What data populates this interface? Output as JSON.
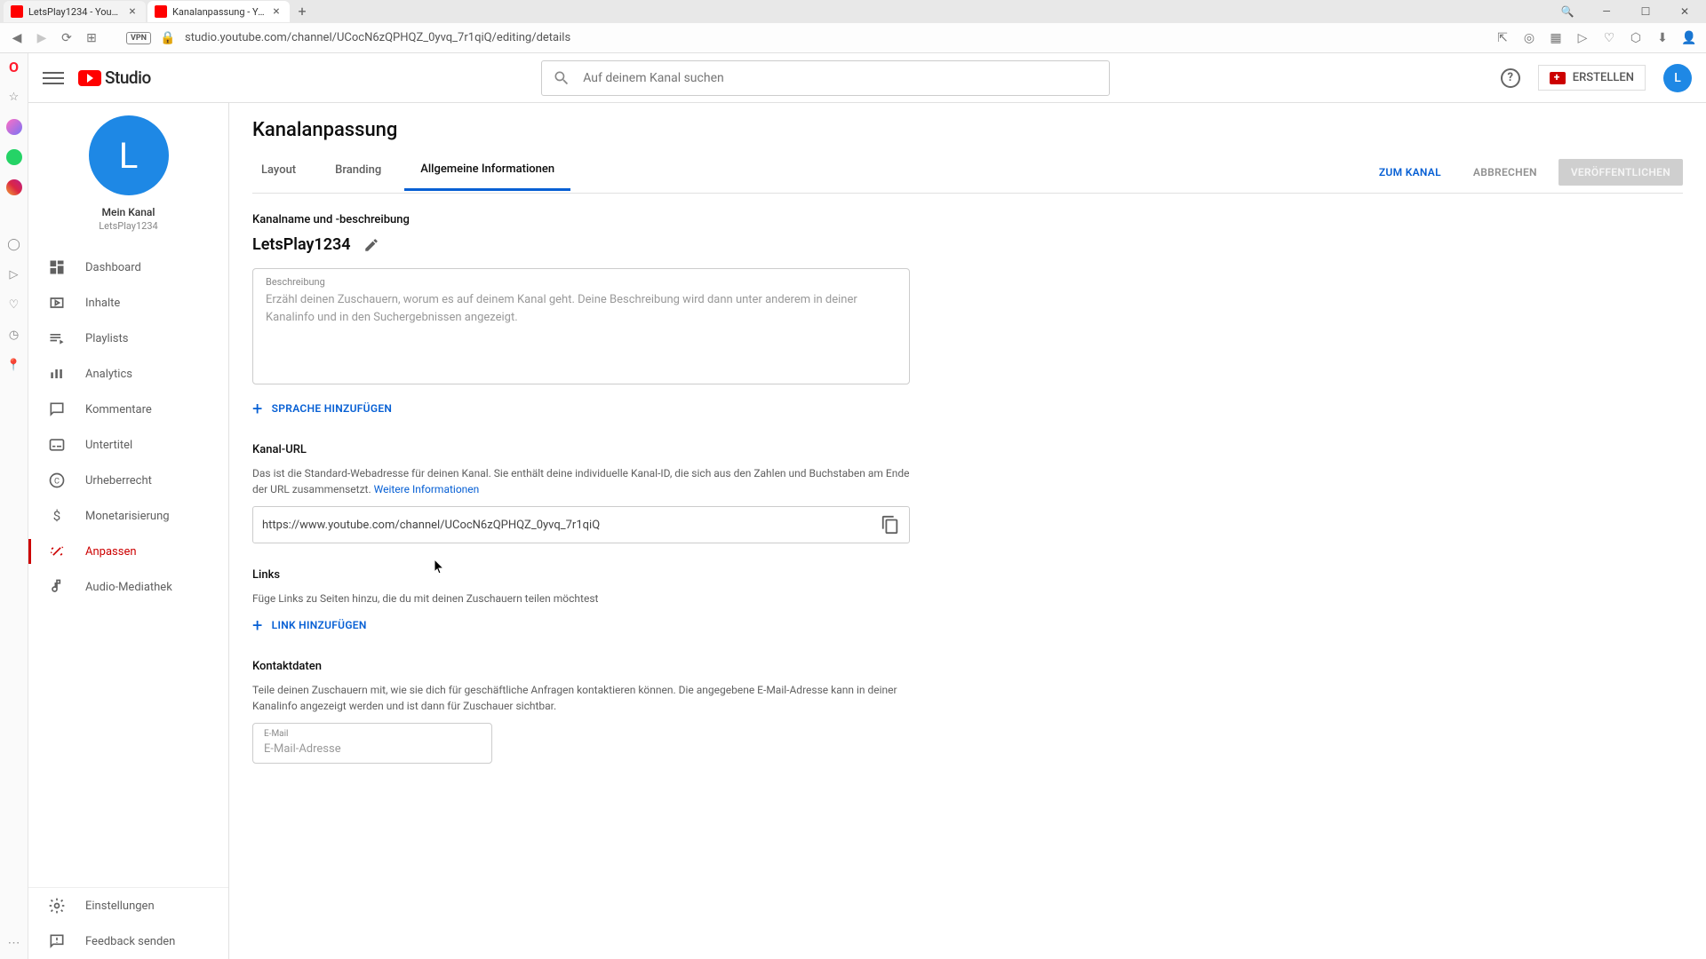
{
  "browser": {
    "tabs": [
      {
        "title": "LetsPlay1234 - YouTube",
        "active": false
      },
      {
        "title": "Kanalanpassung - YouTube",
        "active": true
      }
    ],
    "url": "studio.youtube.com/channel/UCocN6zQPHQZ_0yvq_7r1qiQ/editing/details",
    "vpn": "VPN"
  },
  "header": {
    "logo_text": "Studio",
    "search_placeholder": "Auf deinem Kanal suchen",
    "create_label": "ERSTELLEN",
    "avatar_letter": "L"
  },
  "sidebar": {
    "avatar_letter": "L",
    "my_channel_label": "Mein Kanal",
    "channel_name": "LetsPlay1234",
    "items": [
      {
        "label": "Dashboard"
      },
      {
        "label": "Inhalte"
      },
      {
        "label": "Playlists"
      },
      {
        "label": "Analytics"
      },
      {
        "label": "Kommentare"
      },
      {
        "label": "Untertitel"
      },
      {
        "label": "Urheberrecht"
      },
      {
        "label": "Monetarisierung"
      },
      {
        "label": "Anpassen"
      },
      {
        "label": "Audio-Mediathek"
      }
    ],
    "bottom": [
      {
        "label": "Einstellungen"
      },
      {
        "label": "Feedback senden"
      }
    ]
  },
  "page": {
    "title": "Kanalanpassung",
    "tabs": [
      {
        "label": "Layout"
      },
      {
        "label": "Branding"
      },
      {
        "label": "Allgemeine Informationen"
      }
    ],
    "actions": {
      "to_channel": "ZUM KANAL",
      "cancel": "ABBRECHEN",
      "publish": "VERÖFFENTLICHEN"
    },
    "section_name": {
      "title": "Kanalname und -beschreibung",
      "channel_name": "LetsPlay1234",
      "desc_label": "Beschreibung",
      "desc_placeholder": "Erzähl deinen Zuschauern, worum es auf deinem Kanal geht. Deine Beschreibung wird dann unter anderem in deiner Kanalinfo und in den Suchergebnissen angezeigt.",
      "add_language": "SPRACHE HINZUFÜGEN"
    },
    "section_url": {
      "title": "Kanal-URL",
      "desc": "Das ist die Standard-Webadresse für deinen Kanal. Sie enthält deine individuelle Kanal-ID, die sich aus den Zahlen und Buchstaben am Ende der URL zusammensetzt. ",
      "more_info": "Weitere Informationen",
      "url": "https://www.youtube.com/channel/UCocN6zQPHQZ_0yvq_7r1qiQ"
    },
    "section_links": {
      "title": "Links",
      "desc": "Füge Links zu Seiten hinzu, die du mit deinen Zuschauern teilen möchtest",
      "add_link": "LINK HINZUFÜGEN"
    },
    "section_contact": {
      "title": "Kontaktdaten",
      "desc": "Teile deinen Zuschauern mit, wie sie dich für geschäftliche Anfragen kontaktieren können. Die angegebene E-Mail-Adresse kann in deiner Kanalinfo angezeigt werden und ist dann für Zuschauer sichtbar.",
      "email_label": "E-Mail",
      "email_placeholder": "E-Mail-Adresse"
    }
  }
}
